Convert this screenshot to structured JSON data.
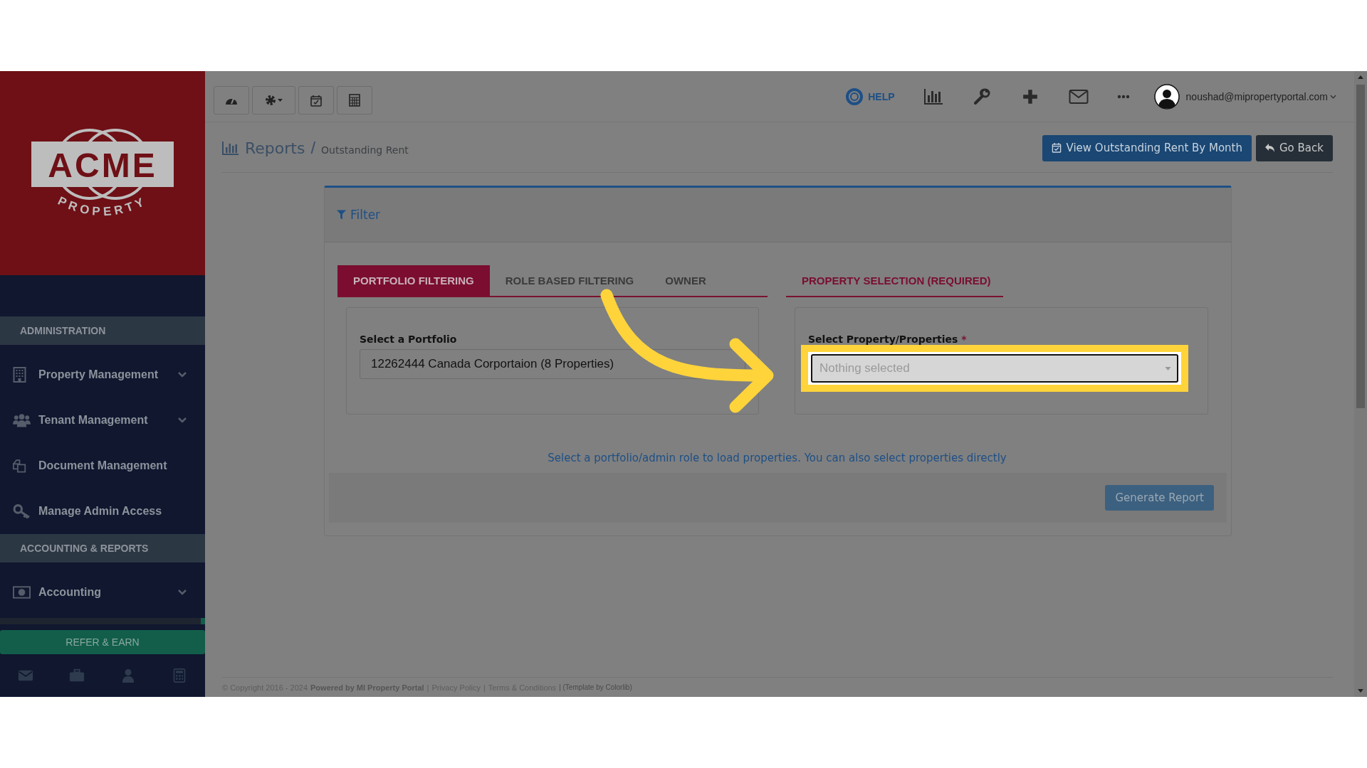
{
  "top_nav": {
    "help_label": "HELP",
    "user_email": "noushad@mipropertyportal.com"
  },
  "sidebar": {
    "logo": {
      "wordmark": "ACME",
      "tagline": "PROPERTY"
    },
    "sections": [
      {
        "heading": "ADMINISTRATION",
        "items": [
          {
            "label": "Property Management",
            "expandable": true
          },
          {
            "label": "Tenant Management",
            "expandable": true
          },
          {
            "label": "Document Management",
            "expandable": false
          },
          {
            "label": "Manage Admin Access",
            "expandable": false
          }
        ]
      },
      {
        "heading": "ACCOUNTING & REPORTS",
        "items": [
          {
            "label": "Accounting",
            "expandable": true
          }
        ]
      }
    ],
    "refer_button": "REFER & EARN"
  },
  "breadcrumb": {
    "title": "Reports",
    "separator": "/",
    "current": "Outstanding Rent"
  },
  "header_buttons": [
    {
      "label": "View Outstanding Rent By Month",
      "kind": "primary"
    },
    {
      "label": "Go Back",
      "kind": "dark"
    }
  ],
  "filter_panel": {
    "title": "Filter",
    "tabs": [
      {
        "label": "PORTFOLIO FILTERING",
        "selected": true
      },
      {
        "label": "ROLE BASED FILTERING",
        "selected": false
      },
      {
        "label": "OWNER",
        "selected": false
      }
    ],
    "portfolio": {
      "label": "Select a Portfolio",
      "value": "12262444 Canada Corportaion (8 Properties)"
    },
    "property_tabs": [
      {
        "label": "PROPERTY SELECTION (REQUIRED)",
        "selected": true
      }
    ],
    "property": {
      "label": "Select Property/Properties",
      "required_mark": "*",
      "placeholder": "Nothing selected",
      "highlighted": true
    },
    "hint": "Select a portfolio/admin role to load properties. You can also select properties directly",
    "generate_button": "Generate Report"
  },
  "footer": {
    "parts": [
      {
        "kind": "text",
        "text": "© Copyright 2016 - 2024"
      },
      {
        "kind": "bold",
        "text": "Powered by MI Property Portal"
      },
      {
        "kind": "sep",
        "text": "|"
      },
      {
        "kind": "link",
        "text": "Privacy Policy"
      },
      {
        "kind": "sep",
        "text": "|"
      },
      {
        "kind": "link",
        "text": "Terms & Conditions"
      },
      {
        "kind": "small",
        "text": "| (Template by Colorlib)"
      }
    ]
  }
}
